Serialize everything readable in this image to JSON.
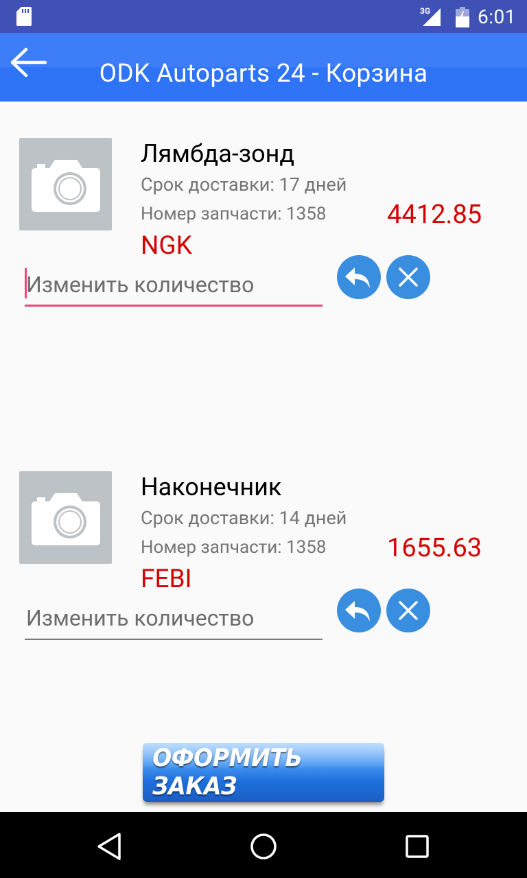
{
  "status_bar": {
    "time": "6:01",
    "network": "3G"
  },
  "app_bar": {
    "title": "ODK Autoparts 24 - Корзина"
  },
  "cart": {
    "items": [
      {
        "name": "Лямбда-зонд",
        "delivery": "Срок доставки: 17 дней",
        "part_number": "Номер запчасти: 1358",
        "price": "4412.85",
        "brand": "NGK",
        "quantity_placeholder": "Изменить количество"
      },
      {
        "name": "Наконечник",
        "delivery": "Срок доставки: 14 дней",
        "part_number": "Номер запчасти: 1358",
        "price": "1655.63",
        "brand": "FEBI",
        "quantity_placeholder": "Изменить количество"
      }
    ]
  },
  "checkout": {
    "label": "ОФОРМИТЬ ЗАКАЗ"
  },
  "colors": {
    "status_bar": "#3f51b5",
    "app_bar": "#2f74f6",
    "price": "#d50000",
    "accent": "#f0437a",
    "action_button": "#3a8ee0"
  },
  "icons": [
    "sd-card-icon",
    "signal-icon",
    "battery-icon",
    "back-arrow-icon",
    "camera-placeholder-icon",
    "undo-icon",
    "close-icon",
    "nav-back-icon",
    "nav-home-icon",
    "nav-recents-icon"
  ]
}
